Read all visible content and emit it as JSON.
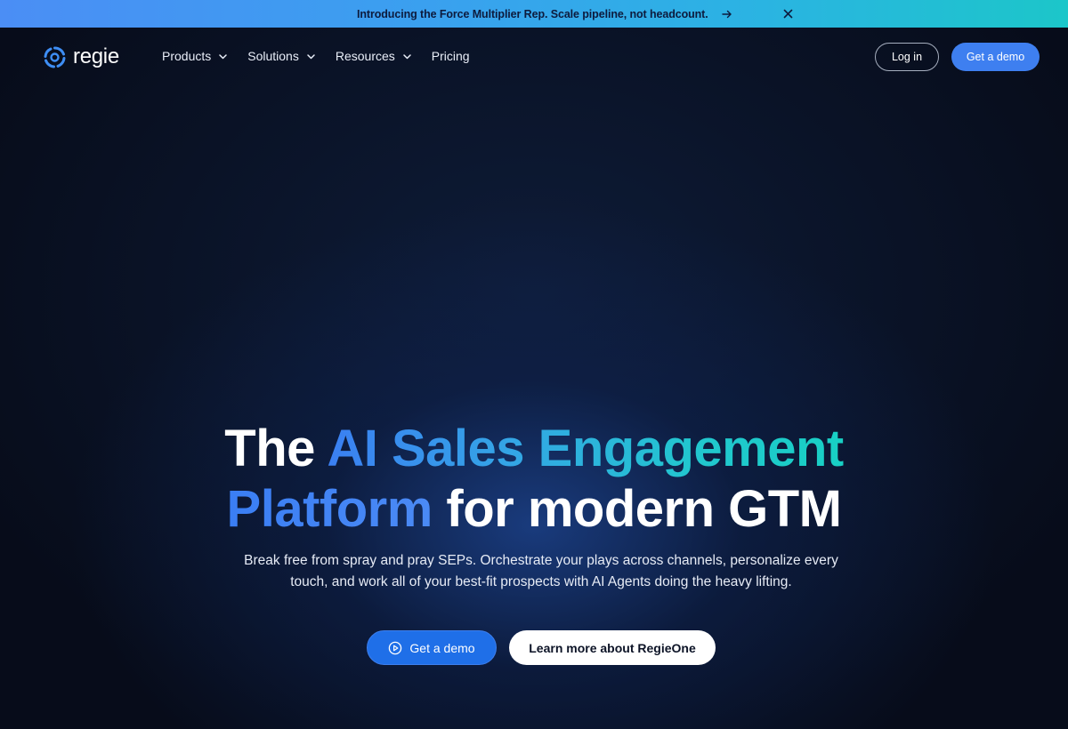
{
  "announcement": {
    "text": "Introducing the Force Multiplier Rep. Scale pipeline, not headcount.",
    "arrow_icon": "arrow-right-icon",
    "close_icon": "close-icon"
  },
  "nav": {
    "logo_text": "regie",
    "menu": [
      {
        "label": "Products",
        "has_dropdown": true
      },
      {
        "label": "Solutions",
        "has_dropdown": true
      },
      {
        "label": "Resources",
        "has_dropdown": true
      },
      {
        "label": "Pricing",
        "has_dropdown": false
      }
    ],
    "login_label": "Log in",
    "demo_label": "Get a demo"
  },
  "hero": {
    "title_part1": "The ",
    "title_highlight1": "AI Sales Engagement",
    "title_highlight2": "Platform",
    "title_part2": " for modern GTM",
    "subtitle": "Break free from spray and pray SEPs. Orchestrate your plays across channels, personalize every touch, and work all of your best-fit prospects with AI Agents doing the heavy lifting.",
    "cta_primary": "Get a demo",
    "cta_secondary": "Learn more about RegieOne"
  },
  "colors": {
    "accent_blue": "#3e7ff0",
    "accent_teal": "#1cc6c9",
    "background": "#070c1a"
  }
}
